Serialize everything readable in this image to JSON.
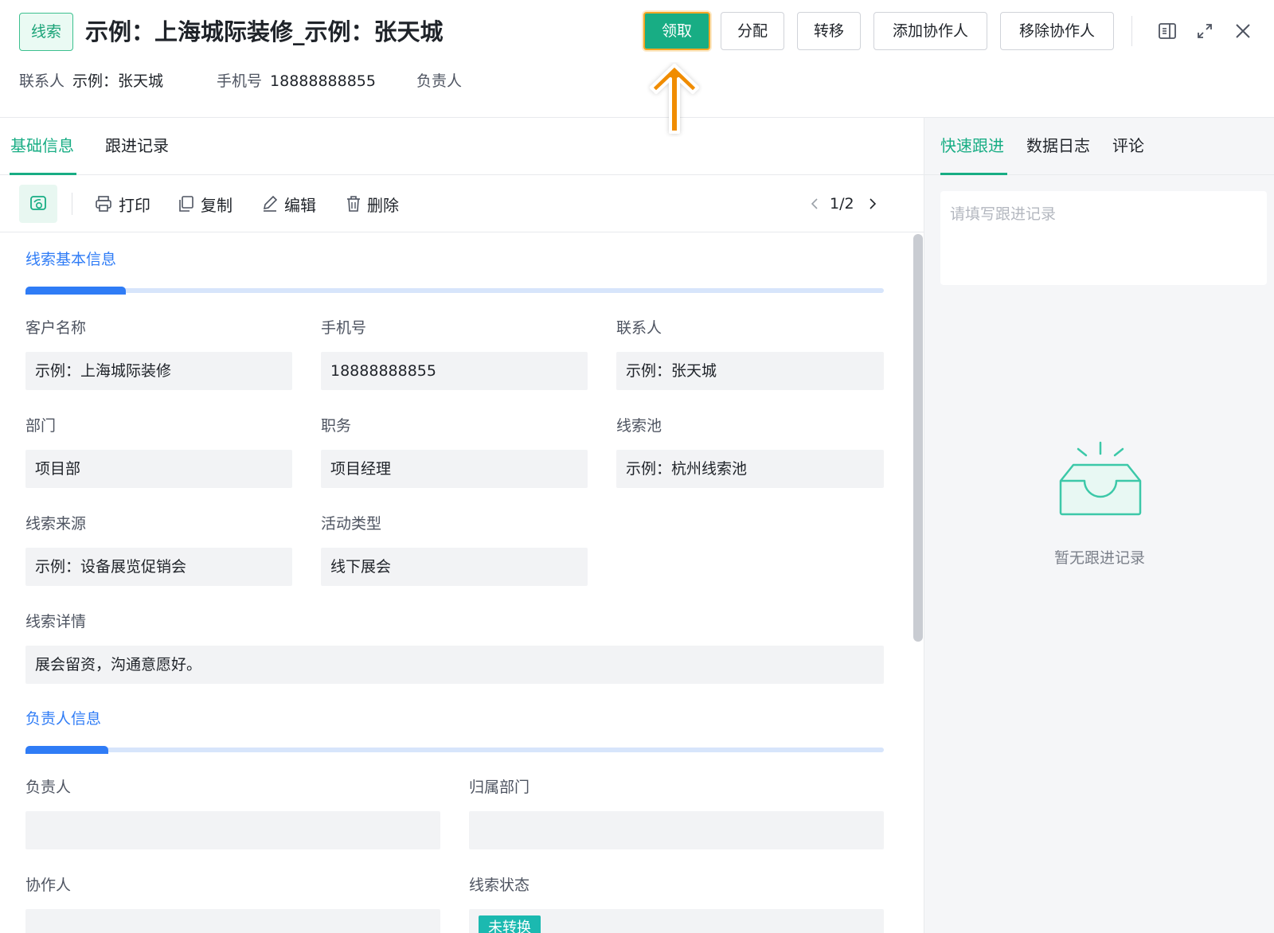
{
  "header": {
    "tag": "线索",
    "title": "示例：上海城际装修_示例：张天城",
    "meta": [
      {
        "label": "联系人",
        "value": "示例：张天城"
      },
      {
        "label": "手机号",
        "value": "18888888855"
      },
      {
        "label": "负责人",
        "value": ""
      }
    ],
    "actions": {
      "claim": "领取",
      "assign": "分配",
      "transfer": "转移",
      "add_collaborator": "添加协作人",
      "remove_collaborator": "移除协作人"
    }
  },
  "left_tabs": [
    {
      "label": "基础信息",
      "active": true
    },
    {
      "label": "跟进记录",
      "active": false
    }
  ],
  "toolbar": {
    "print": "打印",
    "copy": "复制",
    "edit": "编辑",
    "delete": "删除",
    "pager": "1/2"
  },
  "sections": {
    "basic": {
      "title": "线索基本信息",
      "fields": {
        "customer_name": {
          "label": "客户名称",
          "value": "示例：上海城际装修"
        },
        "phone": {
          "label": "手机号",
          "value": "18888888855"
        },
        "contact": {
          "label": "联系人",
          "value": "示例：张天城"
        },
        "department": {
          "label": "部门",
          "value": "项目部"
        },
        "position": {
          "label": "职务",
          "value": "项目经理"
        },
        "lead_pool": {
          "label": "线索池",
          "value": "示例：杭州线索池"
        },
        "source": {
          "label": "线索来源",
          "value": "示例：设备展览促销会"
        },
        "activity_type": {
          "label": "活动类型",
          "value": "线下展会"
        },
        "detail": {
          "label": "线索详情",
          "value": "展会留资，沟通意愿好。"
        }
      }
    },
    "owner": {
      "title": "负责人信息",
      "fields": {
        "owner": {
          "label": "负责人",
          "value": ""
        },
        "owner_dept": {
          "label": "归属部门",
          "value": ""
        },
        "collaborator": {
          "label": "协作人",
          "value": ""
        },
        "status": {
          "label": "线索状态",
          "value": "未转换"
        }
      }
    }
  },
  "right_panel": {
    "tabs": [
      {
        "label": "快速跟进",
        "active": true
      },
      {
        "label": "数据日志",
        "active": false
      },
      {
        "label": "评论",
        "active": false
      }
    ],
    "input_placeholder": "请填写跟进记录",
    "empty_text": "暂无跟进记录"
  },
  "colors": {
    "primary": "#18ad84",
    "accent_border": "#f5a623",
    "section_blue": "#2f7cf6",
    "status_tag": "#1bb9b0"
  }
}
